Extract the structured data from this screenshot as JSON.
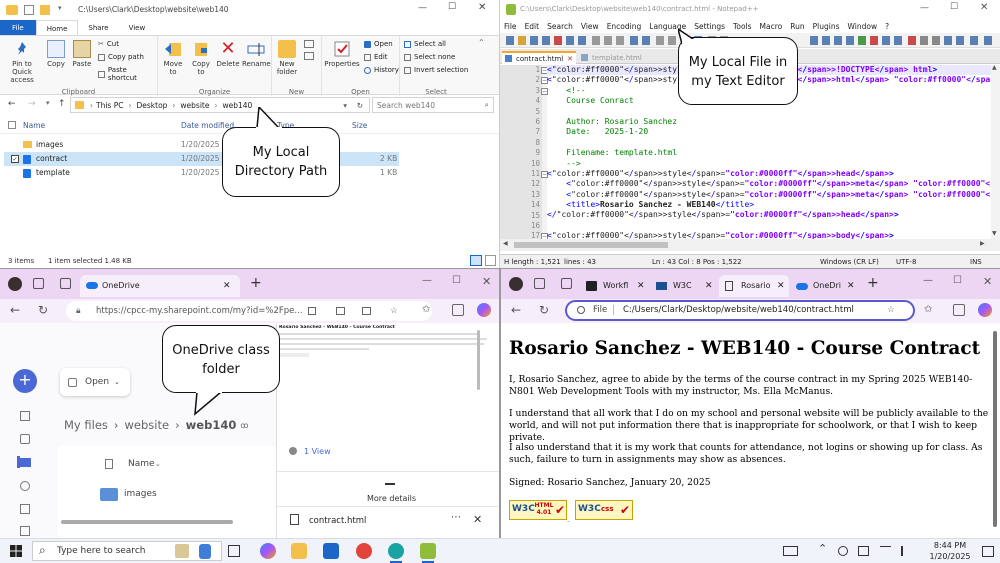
{
  "explorer": {
    "title_path": "C:\\Users\\Clark\\Desktop\\website\\web140",
    "tabs": [
      "File",
      "Home",
      "Share",
      "View"
    ],
    "ribbon": {
      "pin": "Pin to Quick access",
      "copy": "Copy",
      "paste": "Paste",
      "cut": "Cut",
      "copy_path": "Copy path",
      "paste_shortcut": "Paste shortcut",
      "clipboard": "Clipboard",
      "move_to": "Move to",
      "copy_to": "Copy to",
      "delete": "Delete",
      "rename": "Rename",
      "organize": "Organize",
      "new_folder": "New folder",
      "new": "New",
      "properties": "Properties",
      "open": "Open",
      "edit": "Edit",
      "history": "History",
      "open_group": "Open",
      "select_all": "Select all",
      "select_none": "Select none",
      "invert_selection": "Invert selection",
      "select": "Select"
    },
    "breadcrumb": [
      "This PC",
      "Desktop",
      "website",
      "web140"
    ],
    "search_placeholder": "Search web140",
    "columns": {
      "name": "Name",
      "date": "Date modified",
      "type": "Type",
      "size": "Size"
    },
    "files": [
      {
        "name": "images",
        "date": "1/20/2025",
        "size": ""
      },
      {
        "name": "contract",
        "date": "1/20/2025",
        "size": "2 KB"
      },
      {
        "name": "template",
        "date": "1/20/2025",
        "size": "1 KB"
      }
    ],
    "status": {
      "items": "3 items",
      "selected": "1 item selected  1.48 KB"
    }
  },
  "callouts": {
    "dir": "My Local Directory Path",
    "editor": "My Local File in my Text Editor",
    "onedrive": "OneDrive class folder"
  },
  "npp": {
    "title": "C:\\Users\\Clark\\Desktop\\website\\web140\\contract.html - Notepad++",
    "menu": [
      "File",
      "Edit",
      "Search",
      "View",
      "Encoding",
      "Language",
      "Settings",
      "Tools",
      "Macro",
      "Run",
      "Plugins",
      "Window",
      "?"
    ],
    "tabs": [
      "contract.html",
      "template.html"
    ],
    "lines": [
      "<!DOCTYPE html>",
      "<html lang=\"en\">",
      "    <!--",
      "    Course Conract",
      "",
      "    Author: Rosario Sanchez",
      "    Date:   2025-1-20",
      "",
      "    Filename: template.html",
      "    -->",
      "<head>",
      "    <meta charset=\"UTF-8\">",
      "    <meta name=\"viewport\" content=\"width=device-width, initial-scale=1.0\">",
      "    <title>Rosario Sanchez - WEB140</title>",
      "</head>",
      "",
      "<body>"
    ],
    "status": {
      "length": "H length : 1,521",
      "lines": "lines : 43",
      "pos": "Ln : 43   Col : 8   Pos : 1,522",
      "eol": "Windows (CR LF)",
      "enc": "UTF-8",
      "ins": "INS"
    }
  },
  "onedrive": {
    "tab_label": "OneDrive",
    "url": "https://cpcc-my.sharepoint.com/my?id=%2Fpe...",
    "open_label": "Open",
    "breadcrumb": [
      "My files",
      "website",
      "web140"
    ],
    "name_header": "Name",
    "items": [
      "images"
    ],
    "preview_title": "Rosario Sanchez - WEB140 - Course Contract",
    "views": "1 View",
    "more_details": "More details",
    "file": "contract.html"
  },
  "browser": {
    "tabs": [
      "Workfl",
      "W3C",
      "Rosario",
      "OneDri"
    ],
    "file_label": "File",
    "url": "C:/Users/Clark/Desktop/website/web140/contract.html",
    "heading": "Rosario Sanchez - WEB140 - Course Contract",
    "paragraphs": [
      "I, Rosario Sanchez, agree to abide by the terms of the course contract in my Spring 2025 WEB140-N801 Web Development Tools with my instructor, Ms. Ella McManus.",
      "I understand that all work that I do on my school and personal website will be publicly available to the world, and will not put information there that is inappropriate for schoolwork, or that I wish to keep private.",
      "I also understand that it is my work that counts for attendance, not logins or showing up for class. As such, failure to turn in assignments may show as absences.",
      "Signed: Rosario Sanchez, January 20, 2025"
    ],
    "badges": [
      "HTML 4.01",
      "css"
    ]
  },
  "taskbar": {
    "search_placeholder": "Type here to search",
    "time": "8:44 PM",
    "date": "1/20/2025"
  }
}
